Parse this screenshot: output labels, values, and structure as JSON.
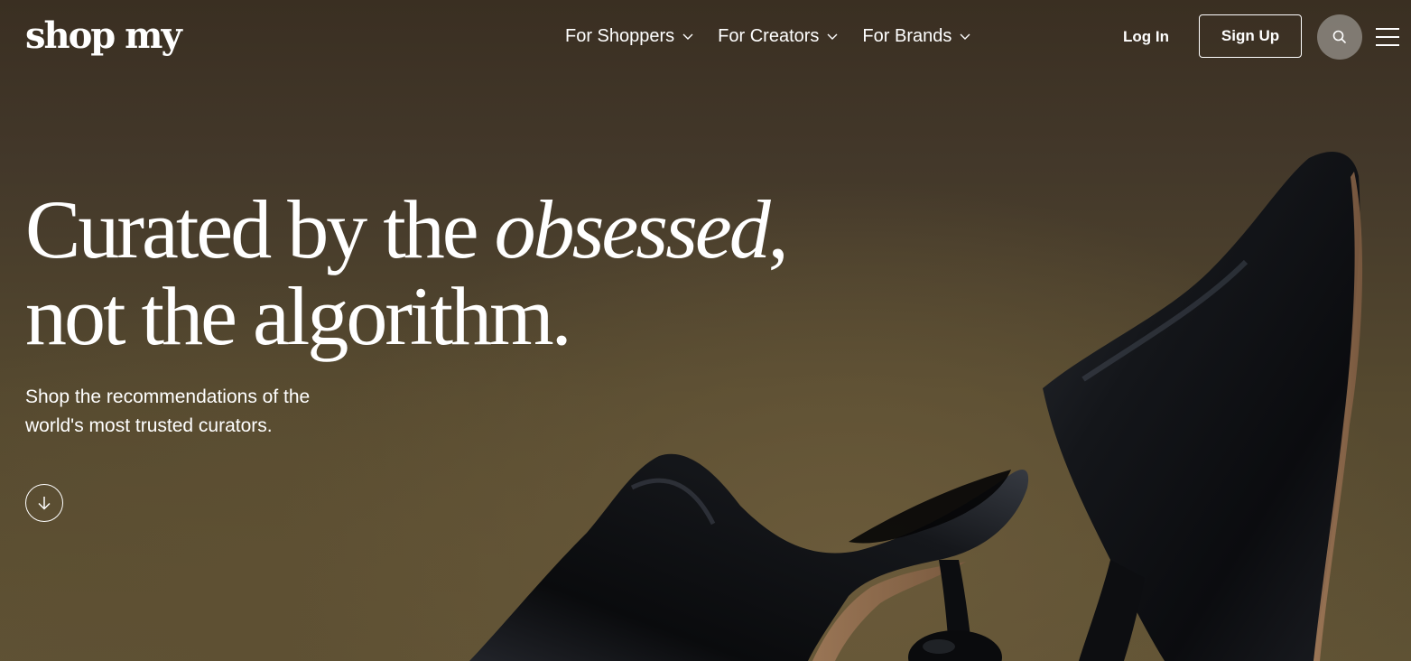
{
  "header": {
    "logo": "shop my",
    "nav": [
      {
        "label": "For Shoppers"
      },
      {
        "label": "For Creators"
      },
      {
        "label": "For Brands"
      }
    ],
    "login_label": "Log In",
    "signup_label": "Sign Up",
    "icons": {
      "search": "search-icon",
      "menu": "hamburger-menu-icon",
      "dropdown": "chevron-down-icon"
    }
  },
  "hero": {
    "headline_part1": "Curated by the ",
    "headline_emphasis": "obsessed",
    "headline_part2": ",",
    "headline_line2": "not the algorithm.",
    "subtext": "Shop the recommendations of the world's most trusted curators.",
    "scroll_icon": "arrow-down-circle-icon"
  },
  "colors": {
    "text": "#ffffff",
    "background": "#4a3f2c",
    "search_button": "#8c8780"
  }
}
